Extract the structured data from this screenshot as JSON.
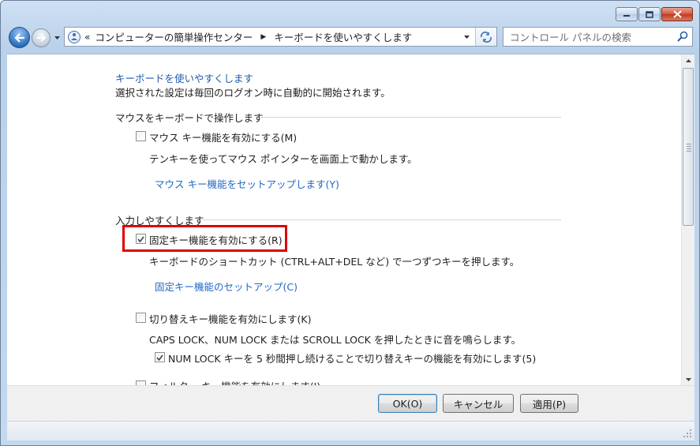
{
  "window": {
    "controls": {
      "minimize_icon": "minimize-icon",
      "maximize_icon": "maximize-icon",
      "close_icon": "close-icon"
    }
  },
  "nav": {
    "breadcrumb_prefix": "«",
    "crumbs": [
      "コンピューターの簡単操作センター",
      "キーボードを使いやすくします"
    ],
    "search_placeholder": "コントロール パネルの検索"
  },
  "page": {
    "title": "キーボードを使いやすくします",
    "subtitle": "選択された設定は毎回のログオン時に自動的に開始されます。",
    "sections": [
      {
        "title": "マウスをキーボードで操作します",
        "option": {
          "label": "マウス キー機能を有効にする(M)",
          "checked": false
        },
        "description": "テンキーを使ってマウス ポインターを画面上で動かします。",
        "setup_link": "マウス キー機能をセットアップします(Y)"
      },
      {
        "title": "入力しやすくします",
        "sticky": {
          "label": "固定キー機能を有効にする(R)",
          "checked": true,
          "description": "キーボードのショートカット (CTRL+ALT+DEL など) で一つずつキーを押します。",
          "setup_link": "固定キー機能のセットアップ(C)"
        },
        "toggle": {
          "label": "切り替えキー機能を有効にします(K)",
          "checked": false,
          "description": "CAPS LOCK、NUM LOCK または SCROLL LOCK を押したときに音を鳴らします。",
          "sub_option": {
            "label": "NUM LOCK キーを 5 秒間押し続けることで切り替えキーの機能を有効にします(5)",
            "checked": true
          }
        },
        "filter": {
          "label": "フィルター キー機能を有効にします(I)",
          "checked": false
        }
      }
    ]
  },
  "footer": {
    "ok": "OK(O)",
    "cancel": "キャンセル",
    "apply": "適用(P)"
  },
  "colors": {
    "link": "#2169c4",
    "highlight": "#e00000"
  }
}
